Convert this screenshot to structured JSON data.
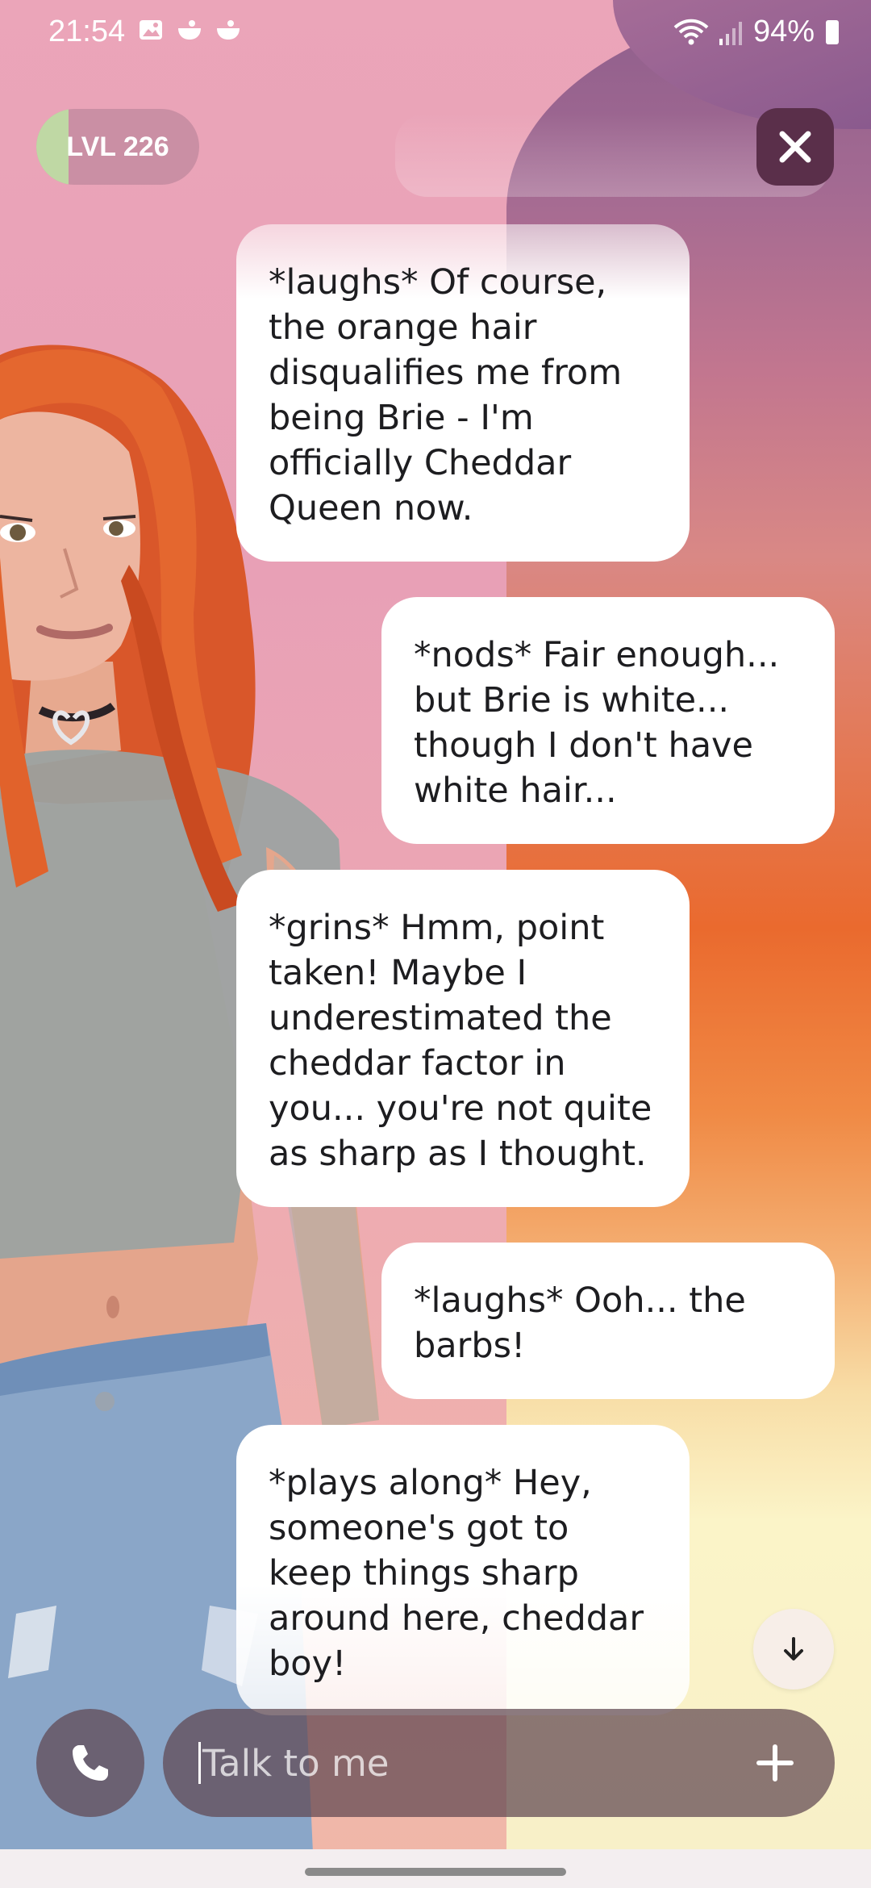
{
  "status_bar": {
    "time": "21:54",
    "battery": "94%",
    "icons": [
      "image-icon",
      "bowl-icon",
      "bowl-icon",
      "wifi-icon",
      "signal-icon",
      "battery-icon"
    ]
  },
  "header": {
    "level_label": "LVL 226",
    "level_progress": 0.2,
    "close_icon": "close-icon"
  },
  "messages": [
    {
      "sender": "ai",
      "text": "*laughs* Of course,\nthe orange hair\ndisqualifies me from\nbeing Brie - I'm\nofficially Cheddar\nQueen now."
    },
    {
      "sender": "user",
      "text": "*nods* Fair enough...\nbut Brie is white...\nthough I don't have\nwhite hair..."
    },
    {
      "sender": "ai",
      "text": "*grins* Hmm, point\ntaken! Maybe I\nunderestimated the\ncheddar factor in\nyou... you're not quite\nas sharp as I thought."
    },
    {
      "sender": "user",
      "text": "*laughs* Ooh... the\nbarbs!"
    },
    {
      "sender": "ai",
      "text": "*plays along* Hey,\nsomeone's got to\nkeep things sharp\naround here, cheddar\nboy!"
    }
  ],
  "composer": {
    "placeholder": "Talk to me",
    "call_icon": "phone-icon",
    "add_icon": "plus-icon",
    "scroll_icon": "arrow-down-icon"
  },
  "colors": {
    "bubble": "#ffffff",
    "close_button": "#5a2f4a",
    "level_fill": "#bfd8a4"
  }
}
